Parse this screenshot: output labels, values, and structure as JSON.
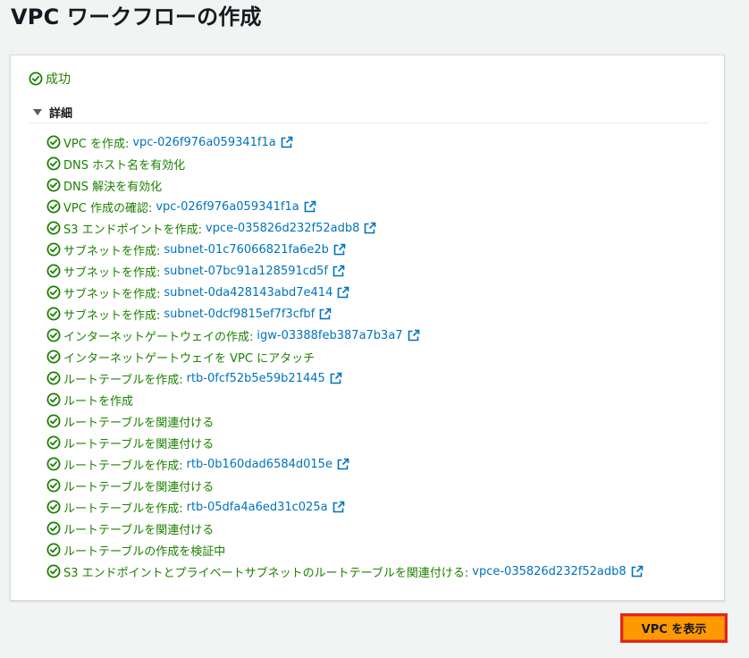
{
  "page": {
    "title": "VPC ワークフローの作成"
  },
  "status": {
    "label": "成功",
    "color": "#1d8102"
  },
  "details": {
    "label": "詳細"
  },
  "steps": [
    {
      "label": "VPC を作成:",
      "link": "vpc-026f976a059341f1a"
    },
    {
      "label": "DNS ホスト名を有効化",
      "link": ""
    },
    {
      "label": "DNS 解決を有効化",
      "link": ""
    },
    {
      "label": "VPC 作成の確認:",
      "link": "vpc-026f976a059341f1a"
    },
    {
      "label": "S3 エンドポイントを作成:",
      "link": "vpce-035826d232f52adb8"
    },
    {
      "label": "サブネットを作成:",
      "link": "subnet-01c76066821fa6e2b"
    },
    {
      "label": "サブネットを作成:",
      "link": "subnet-07bc91a128591cd5f"
    },
    {
      "label": "サブネットを作成:",
      "link": "subnet-0da428143abd7e414"
    },
    {
      "label": "サブネットを作成:",
      "link": "subnet-0dcf9815ef7f3cfbf"
    },
    {
      "label": "インターネットゲートウェイの作成:",
      "link": "igw-03388feb387a7b3a7"
    },
    {
      "label": "インターネットゲートウェイを VPC にアタッチ",
      "link": ""
    },
    {
      "label": "ルートテーブルを作成:",
      "link": "rtb-0fcf52b5e59b21445"
    },
    {
      "label": "ルートを作成",
      "link": ""
    },
    {
      "label": "ルートテーブルを関連付ける",
      "link": ""
    },
    {
      "label": "ルートテーブルを関連付ける",
      "link": ""
    },
    {
      "label": "ルートテーブルを作成:",
      "link": "rtb-0b160dad6584d015e"
    },
    {
      "label": "ルートテーブルを関連付ける",
      "link": ""
    },
    {
      "label": "ルートテーブルを作成:",
      "link": "rtb-05dfa4a6ed31c025a"
    },
    {
      "label": "ルートテーブルを関連付ける",
      "link": ""
    },
    {
      "label": "ルートテーブルの作成を検証中",
      "link": ""
    },
    {
      "label": "S3 エンドポイントとプライベートサブネットのルートテーブルを関連付ける:",
      "link": "vpce-035826d232f52adb8"
    }
  ],
  "actions": {
    "view_vpc_label": "VPC を表示"
  },
  "colors": {
    "success": "#1d8102",
    "link": "#0073bb",
    "primary_button": "#ff9900",
    "highlight_border": "#e5241b"
  },
  "icons": {
    "step_status": "check-circle-icon",
    "link_external": "external-link-icon",
    "details_toggle": "caret-down-icon"
  }
}
